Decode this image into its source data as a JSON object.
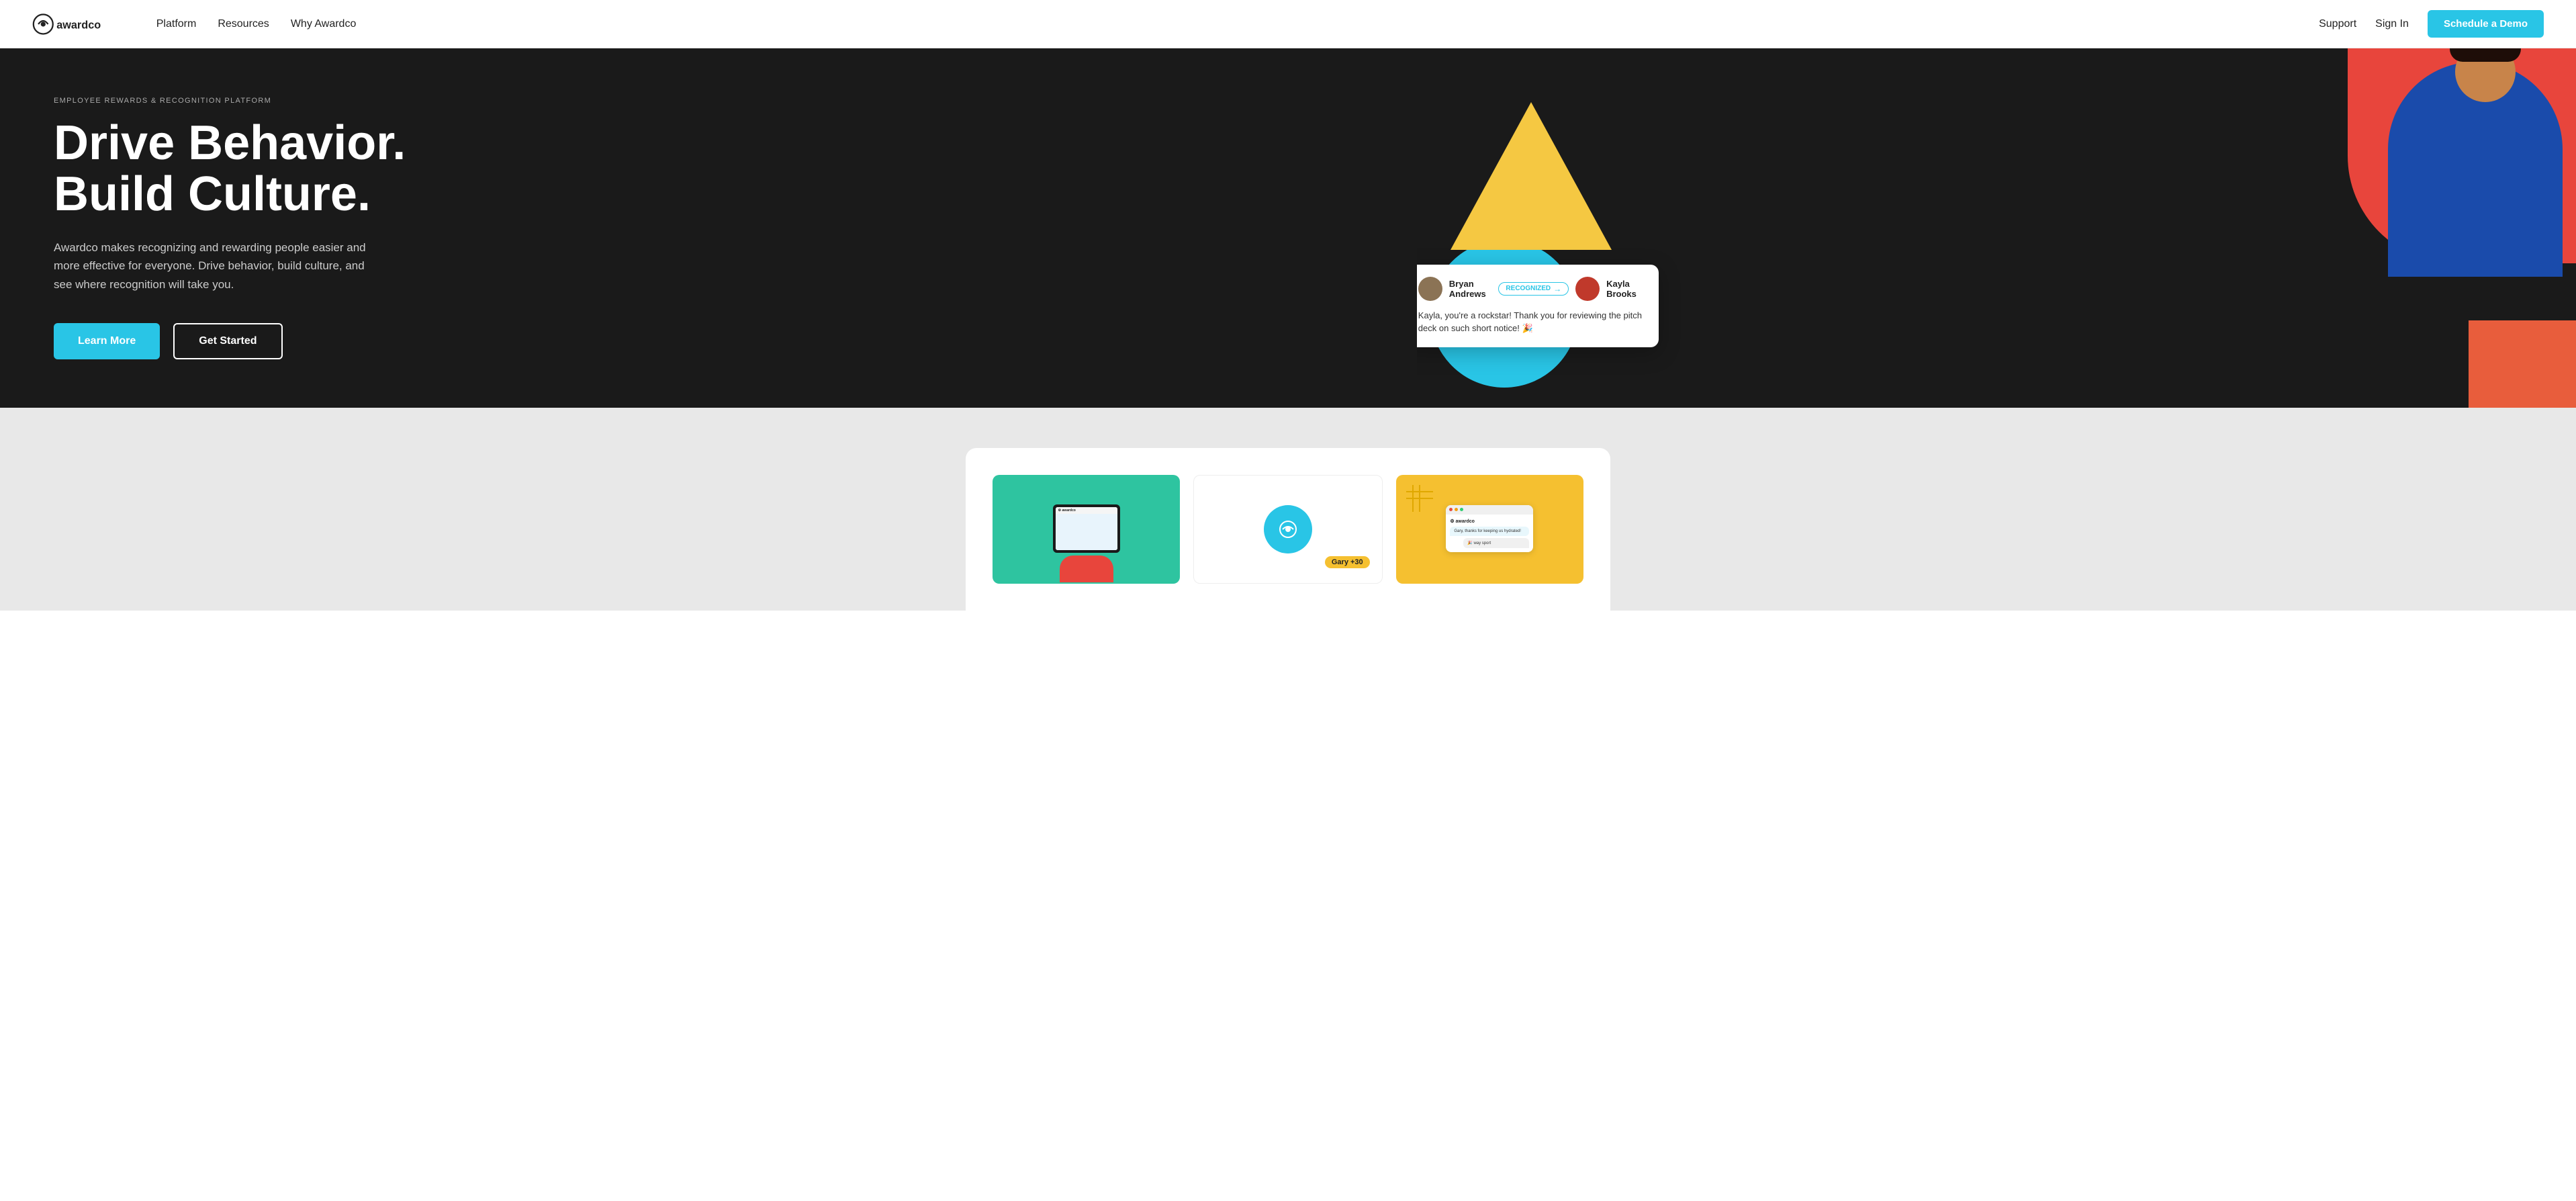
{
  "navbar": {
    "logo_alt": "Awardco",
    "nav_items": [
      "Platform",
      "Resources",
      "Why Awardco"
    ],
    "right_items": [
      "Support",
      "Sign In"
    ],
    "cta_label": "Schedule a Demo"
  },
  "hero": {
    "eyebrow": "EMPLOYEE REWARDS & RECOGNITION PLATFORM",
    "heading_line1": "Drive Behavior.",
    "heading_line2": "Build Culture.",
    "subtext": "Awardco makes recognizing and rewarding people easier and more effective for everyone. Drive behavior, build culture, and see where recognition will take you.",
    "btn_primary": "Learn More",
    "btn_secondary": "Get Started"
  },
  "recognition_card": {
    "sender_name": "Bryan Andrews",
    "badge_text": "RECOGNIZED",
    "receiver_name": "Kayla Brooks",
    "message": "Kayla, you're a rockstar! Thank you for reviewing the pitch deck on such short notice! 🎉"
  },
  "preview_section": {
    "cards": [
      {
        "type": "tablet",
        "bg": "green"
      },
      {
        "type": "phone",
        "bg": "white",
        "gary_label": "Gary +30"
      },
      {
        "type": "desktop",
        "bg": "yellow"
      }
    ]
  }
}
